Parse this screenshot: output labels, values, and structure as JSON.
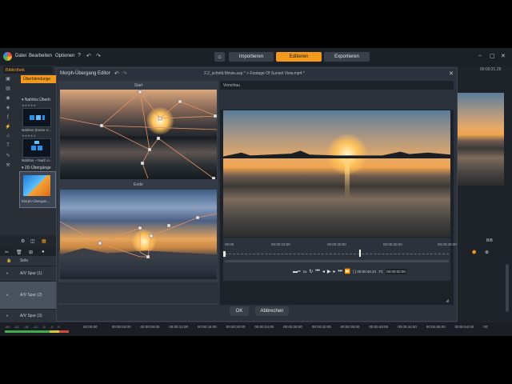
{
  "menubar": {
    "menus": [
      "Datei",
      "Bearbeiten",
      "Optionen"
    ],
    "modes": [
      "Importieren",
      "Editieren",
      "Exportieren"
    ],
    "active_mode": "Editieren",
    "accent_color": "#f39a1c"
  },
  "library": {
    "tab_label": "Bibliothek",
    "category": "Überblendunge",
    "sections": [
      {
        "label": "Nahtlos Überb",
        "items": [
          {
            "label": "Nahtlos (Keine V..."
          },
          {
            "label": "Nahtlos – Nach o..."
          }
        ]
      },
      {
        "label": "2D-Übergänge",
        "items": [
          {
            "label": "Morph-Übergan..."
          }
        ]
      }
    ]
  },
  "dialog": {
    "title": "Morph-Übergang Editor",
    "file1": "2.2_schnitt.Movie.axp *",
    "separator": ">",
    "file2": "Footage Of Sunset View.mp4 *",
    "start_label": "Start",
    "end_label": "Ende",
    "preview_label": "Vorschau",
    "ok_label": "OK",
    "cancel_label": "Abbrechen",
    "scrub_ticks": [
      "00:00",
      "00:00:10:00",
      "00:00:20:00",
      "00:00:30:00",
      "00:00:40:00"
    ],
    "speed": "1x",
    "timecode": "[ ] 00:00:40.24",
    "tc_label": "TC",
    "tc_value": "00:00:00:00",
    "playhead_position": 0.6
  },
  "right_panel": {
    "timecode": "00:00:21.29",
    "info": "BiB"
  },
  "timeline": {
    "tracks": [
      {
        "label": "Solo"
      },
      {
        "label": "A/V Spur (1)"
      },
      {
        "label": "A/V Spur (2)"
      },
      {
        "label": "A/V Spur (3)"
      }
    ],
    "ruler": [
      "00:00:00",
      "00:00:04:00",
      "00:00:08:00",
      "00:00:12:00",
      "00:00:16:00",
      "00:00:20:00",
      "00:00:24:00",
      "00:00:28:00",
      "00:00:32:00",
      "00:00:36:00",
      "00:00:40:00",
      "00:00:44:00",
      "00:00:48:00",
      "00:00:52:00",
      "00:"
    ],
    "meter_labels": [
      "-60",
      "-22",
      "-16",
      "-12",
      "-6",
      "-3",
      "0"
    ]
  }
}
